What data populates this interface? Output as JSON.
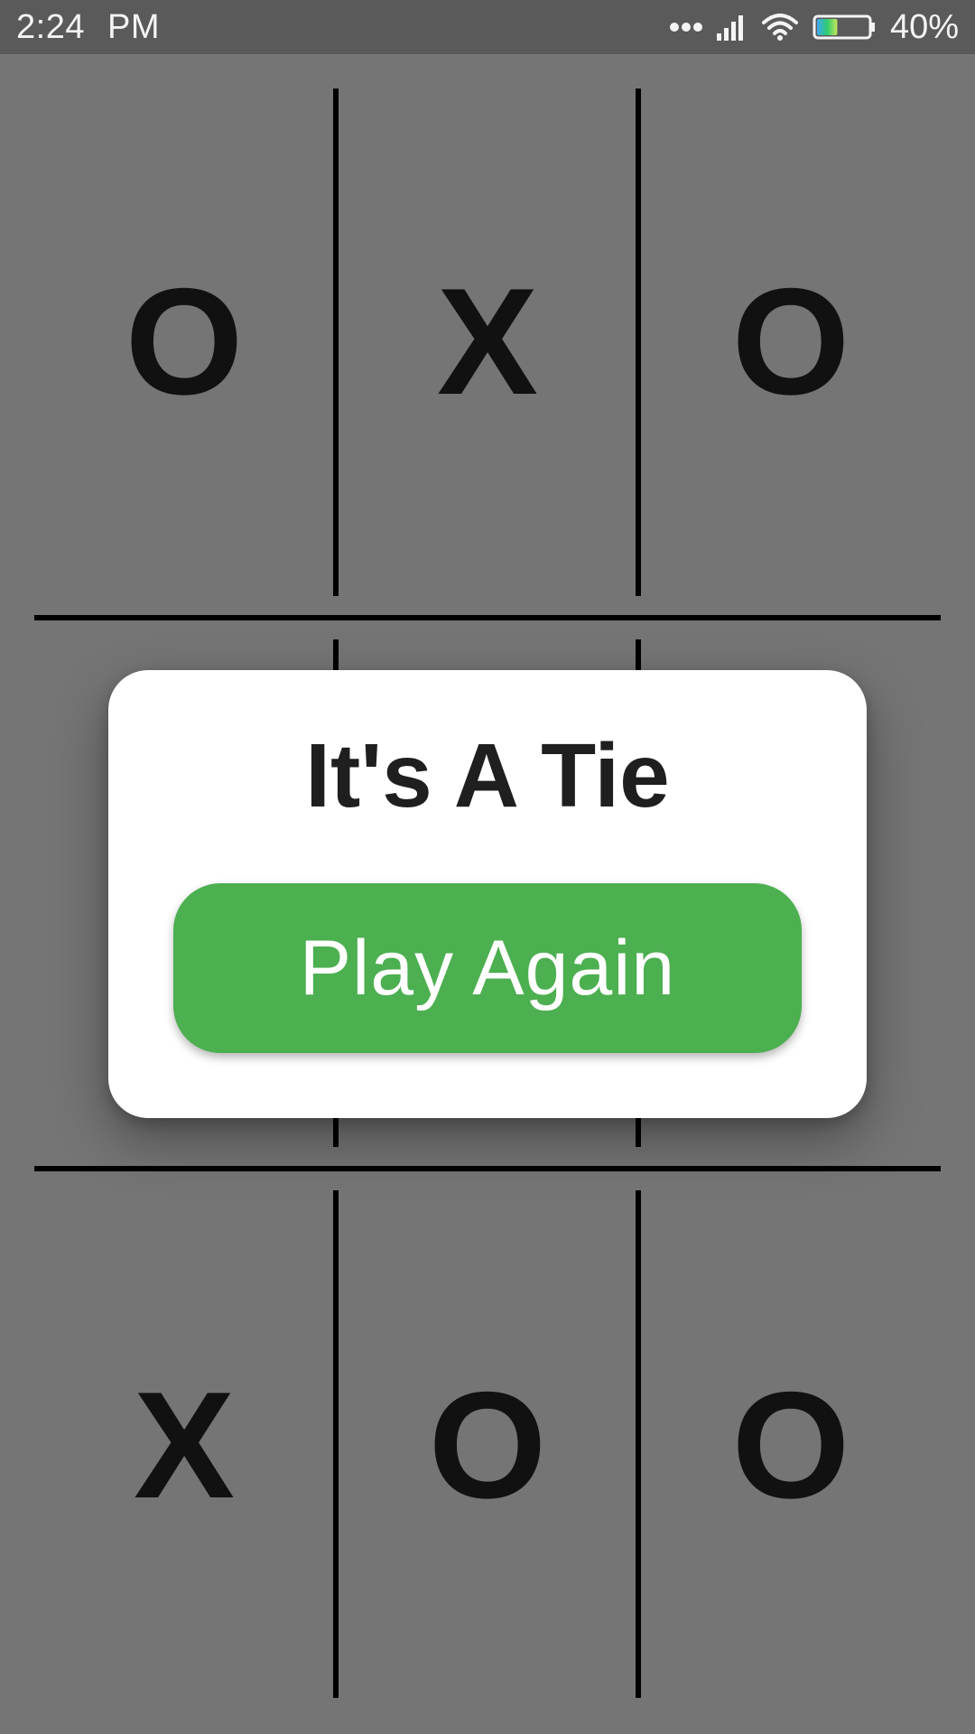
{
  "status_bar": {
    "time": "2:24",
    "ampm": "PM",
    "battery_percent": "40%",
    "battery_level": 0.4,
    "icons": [
      "more-dots-icon",
      "signal-icon",
      "wifi-icon",
      "battery-icon"
    ]
  },
  "board": {
    "cells": [
      [
        "O",
        "X",
        "O"
      ],
      [
        "",
        "",
        ""
      ],
      [
        "X",
        "O",
        "O"
      ]
    ]
  },
  "dialog": {
    "title": "It's A Tie",
    "button_label": "Play Again"
  },
  "colors": {
    "background_dim": "#757575",
    "status_bar": "#5a5a5a",
    "button": "#4caf50",
    "mark": "#111111"
  }
}
